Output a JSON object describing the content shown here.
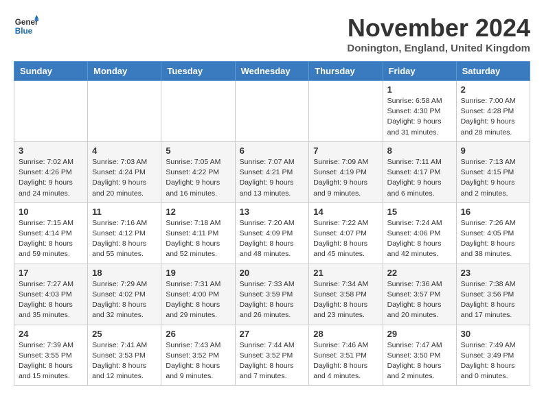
{
  "header": {
    "logo_general": "General",
    "logo_blue": "Blue",
    "month_title": "November 2024",
    "location": "Donington, England, United Kingdom"
  },
  "days_of_week": [
    "Sunday",
    "Monday",
    "Tuesday",
    "Wednesday",
    "Thursday",
    "Friday",
    "Saturday"
  ],
  "weeks": [
    {
      "days": [
        {
          "num": "",
          "info": ""
        },
        {
          "num": "",
          "info": ""
        },
        {
          "num": "",
          "info": ""
        },
        {
          "num": "",
          "info": ""
        },
        {
          "num": "",
          "info": ""
        },
        {
          "num": "1",
          "info": "Sunrise: 6:58 AM\nSunset: 4:30 PM\nDaylight: 9 hours and 31 minutes."
        },
        {
          "num": "2",
          "info": "Sunrise: 7:00 AM\nSunset: 4:28 PM\nDaylight: 9 hours and 28 minutes."
        }
      ]
    },
    {
      "days": [
        {
          "num": "3",
          "info": "Sunrise: 7:02 AM\nSunset: 4:26 PM\nDaylight: 9 hours and 24 minutes."
        },
        {
          "num": "4",
          "info": "Sunrise: 7:03 AM\nSunset: 4:24 PM\nDaylight: 9 hours and 20 minutes."
        },
        {
          "num": "5",
          "info": "Sunrise: 7:05 AM\nSunset: 4:22 PM\nDaylight: 9 hours and 16 minutes."
        },
        {
          "num": "6",
          "info": "Sunrise: 7:07 AM\nSunset: 4:21 PM\nDaylight: 9 hours and 13 minutes."
        },
        {
          "num": "7",
          "info": "Sunrise: 7:09 AM\nSunset: 4:19 PM\nDaylight: 9 hours and 9 minutes."
        },
        {
          "num": "8",
          "info": "Sunrise: 7:11 AM\nSunset: 4:17 PM\nDaylight: 9 hours and 6 minutes."
        },
        {
          "num": "9",
          "info": "Sunrise: 7:13 AM\nSunset: 4:15 PM\nDaylight: 9 hours and 2 minutes."
        }
      ]
    },
    {
      "days": [
        {
          "num": "10",
          "info": "Sunrise: 7:15 AM\nSunset: 4:14 PM\nDaylight: 8 hours and 59 minutes."
        },
        {
          "num": "11",
          "info": "Sunrise: 7:16 AM\nSunset: 4:12 PM\nDaylight: 8 hours and 55 minutes."
        },
        {
          "num": "12",
          "info": "Sunrise: 7:18 AM\nSunset: 4:11 PM\nDaylight: 8 hours and 52 minutes."
        },
        {
          "num": "13",
          "info": "Sunrise: 7:20 AM\nSunset: 4:09 PM\nDaylight: 8 hours and 48 minutes."
        },
        {
          "num": "14",
          "info": "Sunrise: 7:22 AM\nSunset: 4:07 PM\nDaylight: 8 hours and 45 minutes."
        },
        {
          "num": "15",
          "info": "Sunrise: 7:24 AM\nSunset: 4:06 PM\nDaylight: 8 hours and 42 minutes."
        },
        {
          "num": "16",
          "info": "Sunrise: 7:26 AM\nSunset: 4:05 PM\nDaylight: 8 hours and 38 minutes."
        }
      ]
    },
    {
      "days": [
        {
          "num": "17",
          "info": "Sunrise: 7:27 AM\nSunset: 4:03 PM\nDaylight: 8 hours and 35 minutes."
        },
        {
          "num": "18",
          "info": "Sunrise: 7:29 AM\nSunset: 4:02 PM\nDaylight: 8 hours and 32 minutes."
        },
        {
          "num": "19",
          "info": "Sunrise: 7:31 AM\nSunset: 4:00 PM\nDaylight: 8 hours and 29 minutes."
        },
        {
          "num": "20",
          "info": "Sunrise: 7:33 AM\nSunset: 3:59 PM\nDaylight: 8 hours and 26 minutes."
        },
        {
          "num": "21",
          "info": "Sunrise: 7:34 AM\nSunset: 3:58 PM\nDaylight: 8 hours and 23 minutes."
        },
        {
          "num": "22",
          "info": "Sunrise: 7:36 AM\nSunset: 3:57 PM\nDaylight: 8 hours and 20 minutes."
        },
        {
          "num": "23",
          "info": "Sunrise: 7:38 AM\nSunset: 3:56 PM\nDaylight: 8 hours and 17 minutes."
        }
      ]
    },
    {
      "days": [
        {
          "num": "24",
          "info": "Sunrise: 7:39 AM\nSunset: 3:55 PM\nDaylight: 8 hours and 15 minutes."
        },
        {
          "num": "25",
          "info": "Sunrise: 7:41 AM\nSunset: 3:53 PM\nDaylight: 8 hours and 12 minutes."
        },
        {
          "num": "26",
          "info": "Sunrise: 7:43 AM\nSunset: 3:52 PM\nDaylight: 8 hours and 9 minutes."
        },
        {
          "num": "27",
          "info": "Sunrise: 7:44 AM\nSunset: 3:52 PM\nDaylight: 8 hours and 7 minutes."
        },
        {
          "num": "28",
          "info": "Sunrise: 7:46 AM\nSunset: 3:51 PM\nDaylight: 8 hours and 4 minutes."
        },
        {
          "num": "29",
          "info": "Sunrise: 7:47 AM\nSunset: 3:50 PM\nDaylight: 8 hours and 2 minutes."
        },
        {
          "num": "30",
          "info": "Sunrise: 7:49 AM\nSunset: 3:49 PM\nDaylight: 8 hours and 0 minutes."
        }
      ]
    }
  ]
}
